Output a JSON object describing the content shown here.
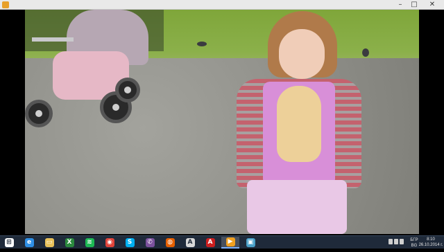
{
  "window": {
    "minimize_glyph": "–",
    "maximize_glyph": "□",
    "close_glyph": "✕"
  },
  "taskbar": {
    "items": [
      {
        "icon": "windows-start-icon",
        "glyph": "⊞",
        "color": "#ffffff"
      },
      {
        "icon": "internet-explorer-icon",
        "glyph": "e",
        "color": "#2f8fe5"
      },
      {
        "icon": "file-explorer-icon",
        "glyph": "▭",
        "color": "#e8c15a"
      },
      {
        "icon": "excel-icon",
        "glyph": "X",
        "color": "#2b8a3e"
      },
      {
        "icon": "spotify-icon",
        "glyph": "≋",
        "color": "#1db954"
      },
      {
        "icon": "chrome-icon",
        "glyph": "◉",
        "color": "#e0443a"
      },
      {
        "icon": "skype-icon",
        "glyph": "S",
        "color": "#00aff0"
      },
      {
        "icon": "viber-icon",
        "glyph": "✆",
        "color": "#7b519d"
      },
      {
        "icon": "firefox-icon",
        "glyph": "◍",
        "color": "#e66000"
      },
      {
        "icon": "pdf-reader-icon",
        "glyph": "A",
        "color": "#d8d8d8"
      },
      {
        "icon": "acrobat-icon",
        "glyph": "A",
        "color": "#cc1f1f"
      },
      {
        "icon": "media-player-icon",
        "glyph": "▶",
        "color": "#f0a020"
      },
      {
        "icon": "photo-viewer-icon",
        "glyph": "▣",
        "color": "#4aa0c8"
      }
    ],
    "active_index": 11,
    "tray": {
      "language": "БГР",
      "language_sub": "BG",
      "time": "8:10",
      "date": "26.10.2014 г."
    }
  }
}
